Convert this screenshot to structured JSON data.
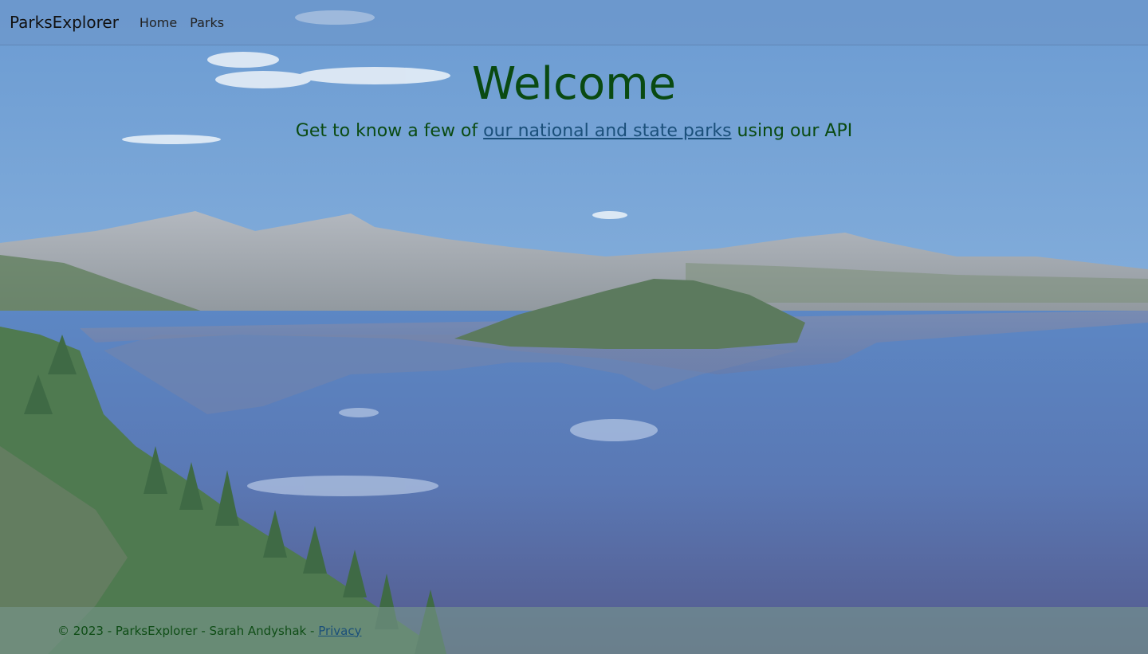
{
  "navbar": {
    "brand": "ParksExplorer",
    "links": [
      {
        "label": "Home"
      },
      {
        "label": "Parks"
      }
    ]
  },
  "hero": {
    "title": "Welcome",
    "subtitle_prefix": "Get to know a few of ",
    "subtitle_link": "our national and state parks",
    "subtitle_suffix": " using our API"
  },
  "footer": {
    "copyright": "© 2023 - ParksExplorer - Sarah Andyshak - ",
    "privacy_link": "Privacy"
  },
  "colors": {
    "heading_green": "#0a4a12",
    "link_blue": "#1a4f7a",
    "sky": "#6d9bd0",
    "lake": "#4d6fa8"
  },
  "background_image": "crater-lake-landscape"
}
